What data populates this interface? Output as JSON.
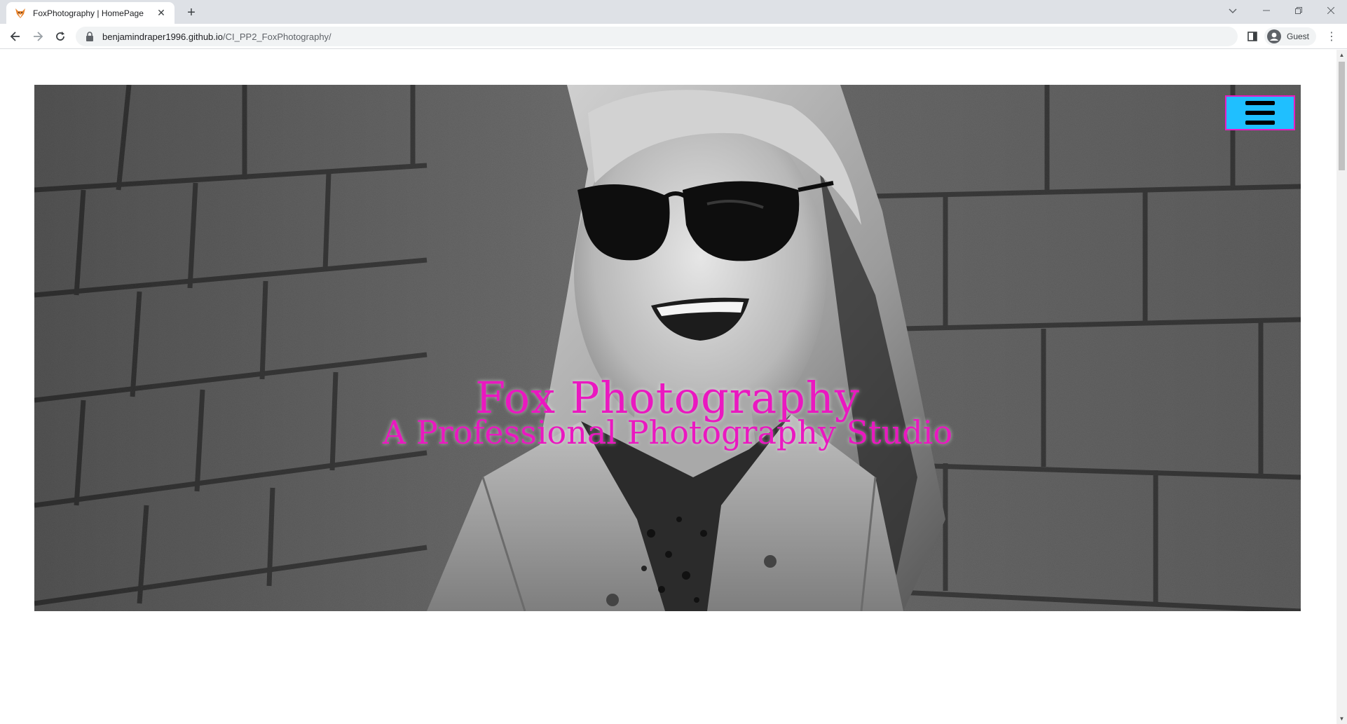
{
  "browser": {
    "tab": {
      "title": "FoxPhotography | HomePage",
      "favicon": "fox-icon"
    },
    "new_tab_icon": "plus-icon",
    "address": {
      "host": "benjamindraper1996.github.io",
      "path": "/CI_PP2_FoxPhotography/"
    },
    "profile": {
      "label": "Guest"
    }
  },
  "page": {
    "hero": {
      "title": "Fox Photography",
      "subtitle": "A Professional Photography Studio",
      "menu_button_icon": "hamburger-menu-icon"
    }
  },
  "colors": {
    "accent_pink": "#ea18c0",
    "menu_button_bg": "#1fbfff"
  }
}
